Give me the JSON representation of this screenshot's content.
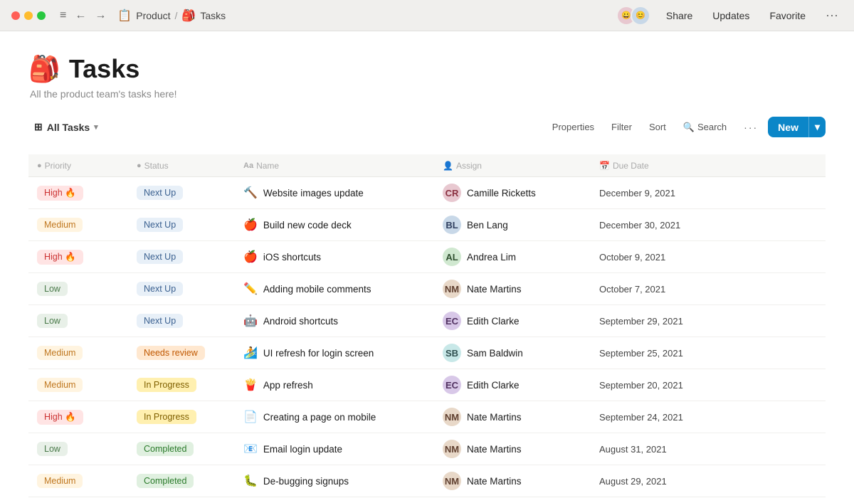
{
  "titlebar": {
    "breadcrumb_parent": "Product",
    "breadcrumb_current": "Tasks",
    "share_label": "Share",
    "updates_label": "Updates",
    "favorite_label": "Favorite"
  },
  "page": {
    "icon": "🎒",
    "title": "Tasks",
    "subtitle": "All the product team's tasks here!",
    "view_label": "All Tasks",
    "toolbar": {
      "properties_label": "Properties",
      "filter_label": "Filter",
      "sort_label": "Sort",
      "search_label": "Search",
      "new_label": "New"
    }
  },
  "table": {
    "columns": [
      {
        "key": "priority",
        "label": "Priority",
        "icon": "○"
      },
      {
        "key": "status",
        "label": "Status",
        "icon": "○"
      },
      {
        "key": "name",
        "label": "Name",
        "icon": "Aa"
      },
      {
        "key": "assign",
        "label": "Assign",
        "icon": "👤"
      },
      {
        "key": "duedate",
        "label": "Due Date",
        "icon": "📅"
      }
    ],
    "rows": [
      {
        "priority": "High",
        "priority_class": "badge-high",
        "priority_emoji": "🔥",
        "status": "Next Up",
        "status_class": "status-next-up",
        "task_emoji": "🔨",
        "task_name": "Website images update",
        "assignee": "Camille Ricketts",
        "assignee_initials": "CR",
        "avatar_class": "avatar-a",
        "due_date": "December 9, 2021"
      },
      {
        "priority": "Medium",
        "priority_class": "badge-medium",
        "priority_emoji": "",
        "status": "Next Up",
        "status_class": "status-next-up",
        "task_emoji": "🍎",
        "task_name": "Build new code deck",
        "assignee": "Ben Lang",
        "assignee_initials": "BL",
        "avatar_class": "avatar-b",
        "due_date": "December 30, 2021"
      },
      {
        "priority": "High",
        "priority_class": "badge-high",
        "priority_emoji": "🔥",
        "status": "Next Up",
        "status_class": "status-next-up",
        "task_emoji": "🍎",
        "task_name": "iOS shortcuts",
        "assignee": "Andrea Lim",
        "assignee_initials": "AL",
        "avatar_class": "avatar-c",
        "due_date": "October 9, 2021"
      },
      {
        "priority": "Low",
        "priority_class": "badge-low",
        "priority_emoji": "",
        "status": "Next Up",
        "status_class": "status-next-up",
        "task_emoji": "✏️",
        "task_name": "Adding mobile comments",
        "assignee": "Nate Martins",
        "assignee_initials": "NM",
        "avatar_class": "avatar-d",
        "due_date": "October 7, 2021"
      },
      {
        "priority": "Low",
        "priority_class": "badge-low",
        "priority_emoji": "",
        "status": "Next Up",
        "status_class": "status-next-up",
        "task_emoji": "🤖",
        "task_name": "Android shortcuts",
        "assignee": "Edith Clarke",
        "assignee_initials": "EC",
        "avatar_class": "avatar-e",
        "due_date": "September 29, 2021"
      },
      {
        "priority": "Medium",
        "priority_class": "badge-medium",
        "priority_emoji": "",
        "status": "Needs review",
        "status_class": "status-needs-review",
        "task_emoji": "🏄",
        "task_name": "UI refresh for login screen",
        "assignee": "Sam Baldwin",
        "assignee_initials": "SB",
        "avatar_class": "avatar-f",
        "due_date": "September 25, 2021"
      },
      {
        "priority": "Medium",
        "priority_class": "badge-medium",
        "priority_emoji": "",
        "status": "In Progress",
        "status_class": "status-in-progress",
        "task_emoji": "🍟",
        "task_name": "App refresh",
        "assignee": "Edith Clarke",
        "assignee_initials": "EC",
        "avatar_class": "avatar-e",
        "due_date": "September 20, 2021"
      },
      {
        "priority": "High",
        "priority_class": "badge-high",
        "priority_emoji": "🔥",
        "status": "In Progress",
        "status_class": "status-in-progress",
        "task_emoji": "📄",
        "task_name": "Creating a page on mobile",
        "assignee": "Nate Martins",
        "assignee_initials": "NM",
        "avatar_class": "avatar-d",
        "due_date": "September 24, 2021"
      },
      {
        "priority": "Low",
        "priority_class": "badge-low",
        "priority_emoji": "",
        "status": "Completed",
        "status_class": "status-completed",
        "task_emoji": "📧",
        "task_name": "Email login update",
        "assignee": "Nate Martins",
        "assignee_initials": "NM",
        "avatar_class": "avatar-d",
        "due_date": "August 31, 2021"
      },
      {
        "priority": "Medium",
        "priority_class": "badge-medium",
        "priority_emoji": "",
        "status": "Completed",
        "status_class": "status-completed",
        "task_emoji": "🐛",
        "task_name": "De-bugging signups",
        "assignee": "Nate Martins",
        "assignee_initials": "NM",
        "avatar_class": "avatar-d",
        "due_date": "August 29, 2021"
      }
    ]
  }
}
